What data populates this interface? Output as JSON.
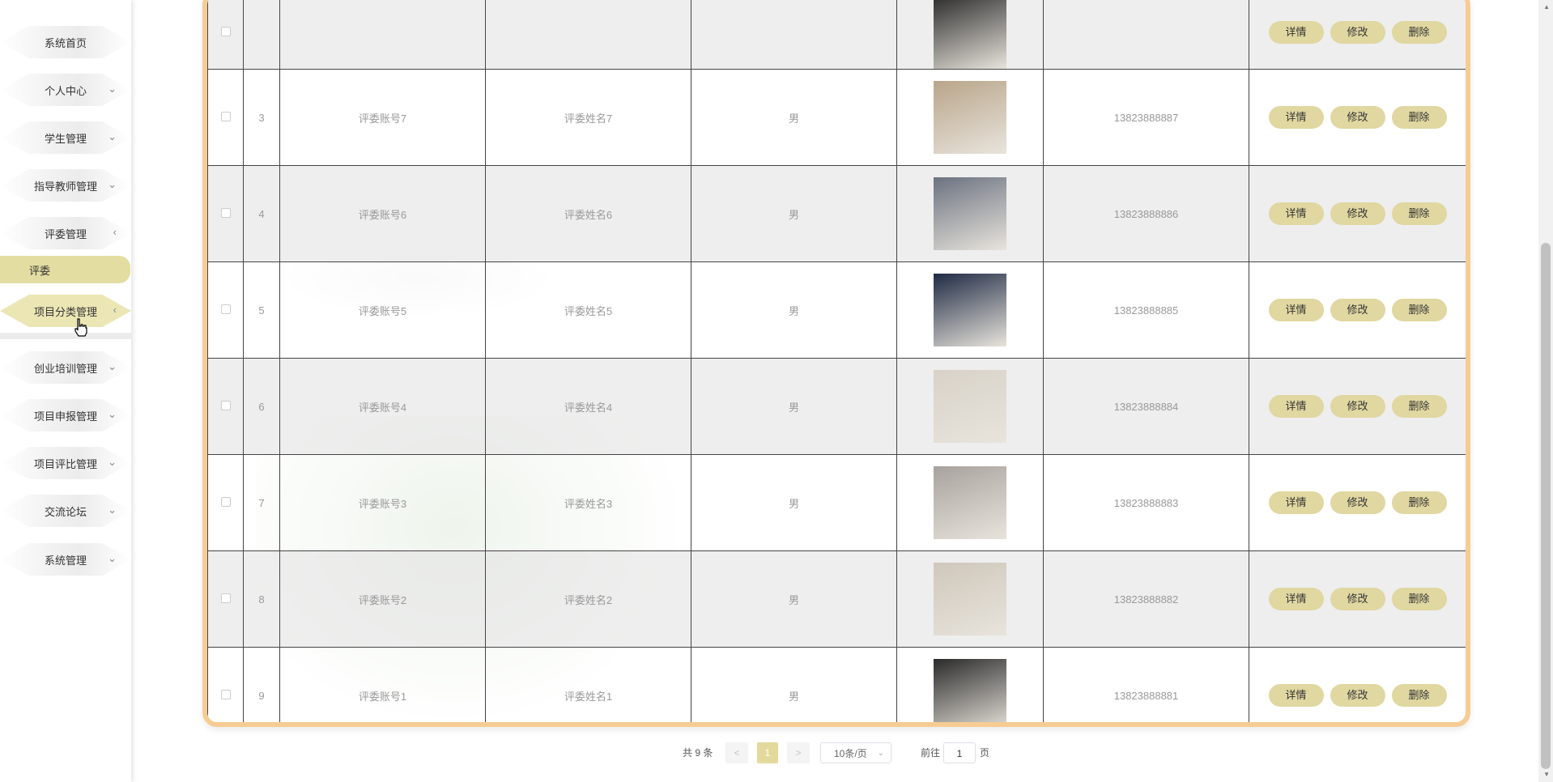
{
  "sidebar": {
    "items": [
      {
        "label": "系统首页",
        "chevron": ""
      },
      {
        "label": "个人中心",
        "chevron": "⌄"
      },
      {
        "label": "学生管理",
        "chevron": "⌄"
      },
      {
        "label": "指导教师管理",
        "chevron": "⌄"
      },
      {
        "label": "评委管理",
        "chevron": "‹"
      },
      {
        "label": "项目分类管理",
        "chevron": "‹"
      },
      {
        "label": "创业培训管理",
        "chevron": "⌄"
      },
      {
        "label": "项目申报管理",
        "chevron": "⌄"
      },
      {
        "label": "项目评比管理",
        "chevron": "⌄"
      },
      {
        "label": "交流论坛",
        "chevron": "⌄"
      },
      {
        "label": "系统管理",
        "chevron": "⌄"
      }
    ],
    "sub_item": {
      "label": "评委"
    }
  },
  "table": {
    "rows": [
      {
        "index": "",
        "account": "",
        "name": "",
        "gender": "",
        "phone": ""
      },
      {
        "index": "3",
        "account": "评委账号7",
        "name": "评委姓名7",
        "gender": "男",
        "phone": "13823888887"
      },
      {
        "index": "4",
        "account": "评委账号6",
        "name": "评委姓名6",
        "gender": "男",
        "phone": "13823888886"
      },
      {
        "index": "5",
        "account": "评委账号5",
        "name": "评委姓名5",
        "gender": "男",
        "phone": "13823888885"
      },
      {
        "index": "6",
        "account": "评委账号4",
        "name": "评委姓名4",
        "gender": "男",
        "phone": "13823888884"
      },
      {
        "index": "7",
        "account": "评委账号3",
        "name": "评委姓名3",
        "gender": "男",
        "phone": "13823888883"
      },
      {
        "index": "8",
        "account": "评委账号2",
        "name": "评委姓名2",
        "gender": "男",
        "phone": "13823888882"
      },
      {
        "index": "9",
        "account": "评委账号1",
        "name": "评委姓名1",
        "gender": "男",
        "phone": "13823888881"
      }
    ],
    "actions": {
      "detail": "详情",
      "edit": "修改",
      "delete": "删除"
    }
  },
  "pagination": {
    "total": "共 9 条",
    "prev": "<",
    "current": "1",
    "next": ">",
    "page_size": "10条/页",
    "goto_label": "前往",
    "goto_value": "1",
    "page_suffix": "页"
  },
  "colors": {
    "card_border": "#f6cc94",
    "button_bg": "#e0d7a1",
    "active_nav": "#ebe6b4",
    "current_page": "#e3d99c"
  }
}
